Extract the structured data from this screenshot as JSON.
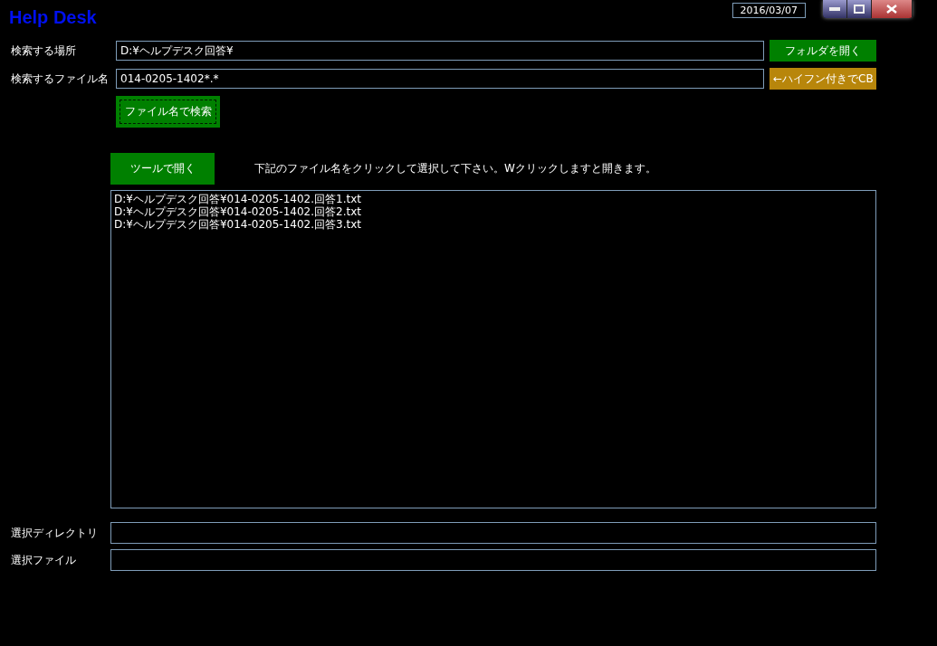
{
  "window": {
    "title": "Help Desk",
    "date": "2016/03/07"
  },
  "search": {
    "location_label": "検索する場所",
    "location_value": "D:¥ヘルプデスク回答¥",
    "open_folder_button": "フォルダを開く",
    "filename_label": "検索するファイル名",
    "filename_value": "014-0205-1402*.*",
    "hyphen_button": "←ハイフン付きでCB",
    "search_button": {
      "label": "ファイル名で検索",
      "focused": true
    }
  },
  "open_tool_button": "ツールで開く",
  "instruction": "下記のファイル名をクリックして選択して下さい。Wクリックしますと開きます。",
  "results": [
    {
      "path": "D:¥ヘルプデスク回答¥014-0205-1402.回答1.txt",
      "selected": false
    },
    {
      "path": "D:¥ヘルプデスク回答¥014-0205-1402.回答2.txt",
      "selected": false
    },
    {
      "path": "D:¥ヘルプデスク回答¥014-0205-1402.回答3.txt",
      "selected": false
    }
  ],
  "selection": {
    "directory_label": "選択ディレクトリ",
    "file_label": "選択ファイル"
  }
}
